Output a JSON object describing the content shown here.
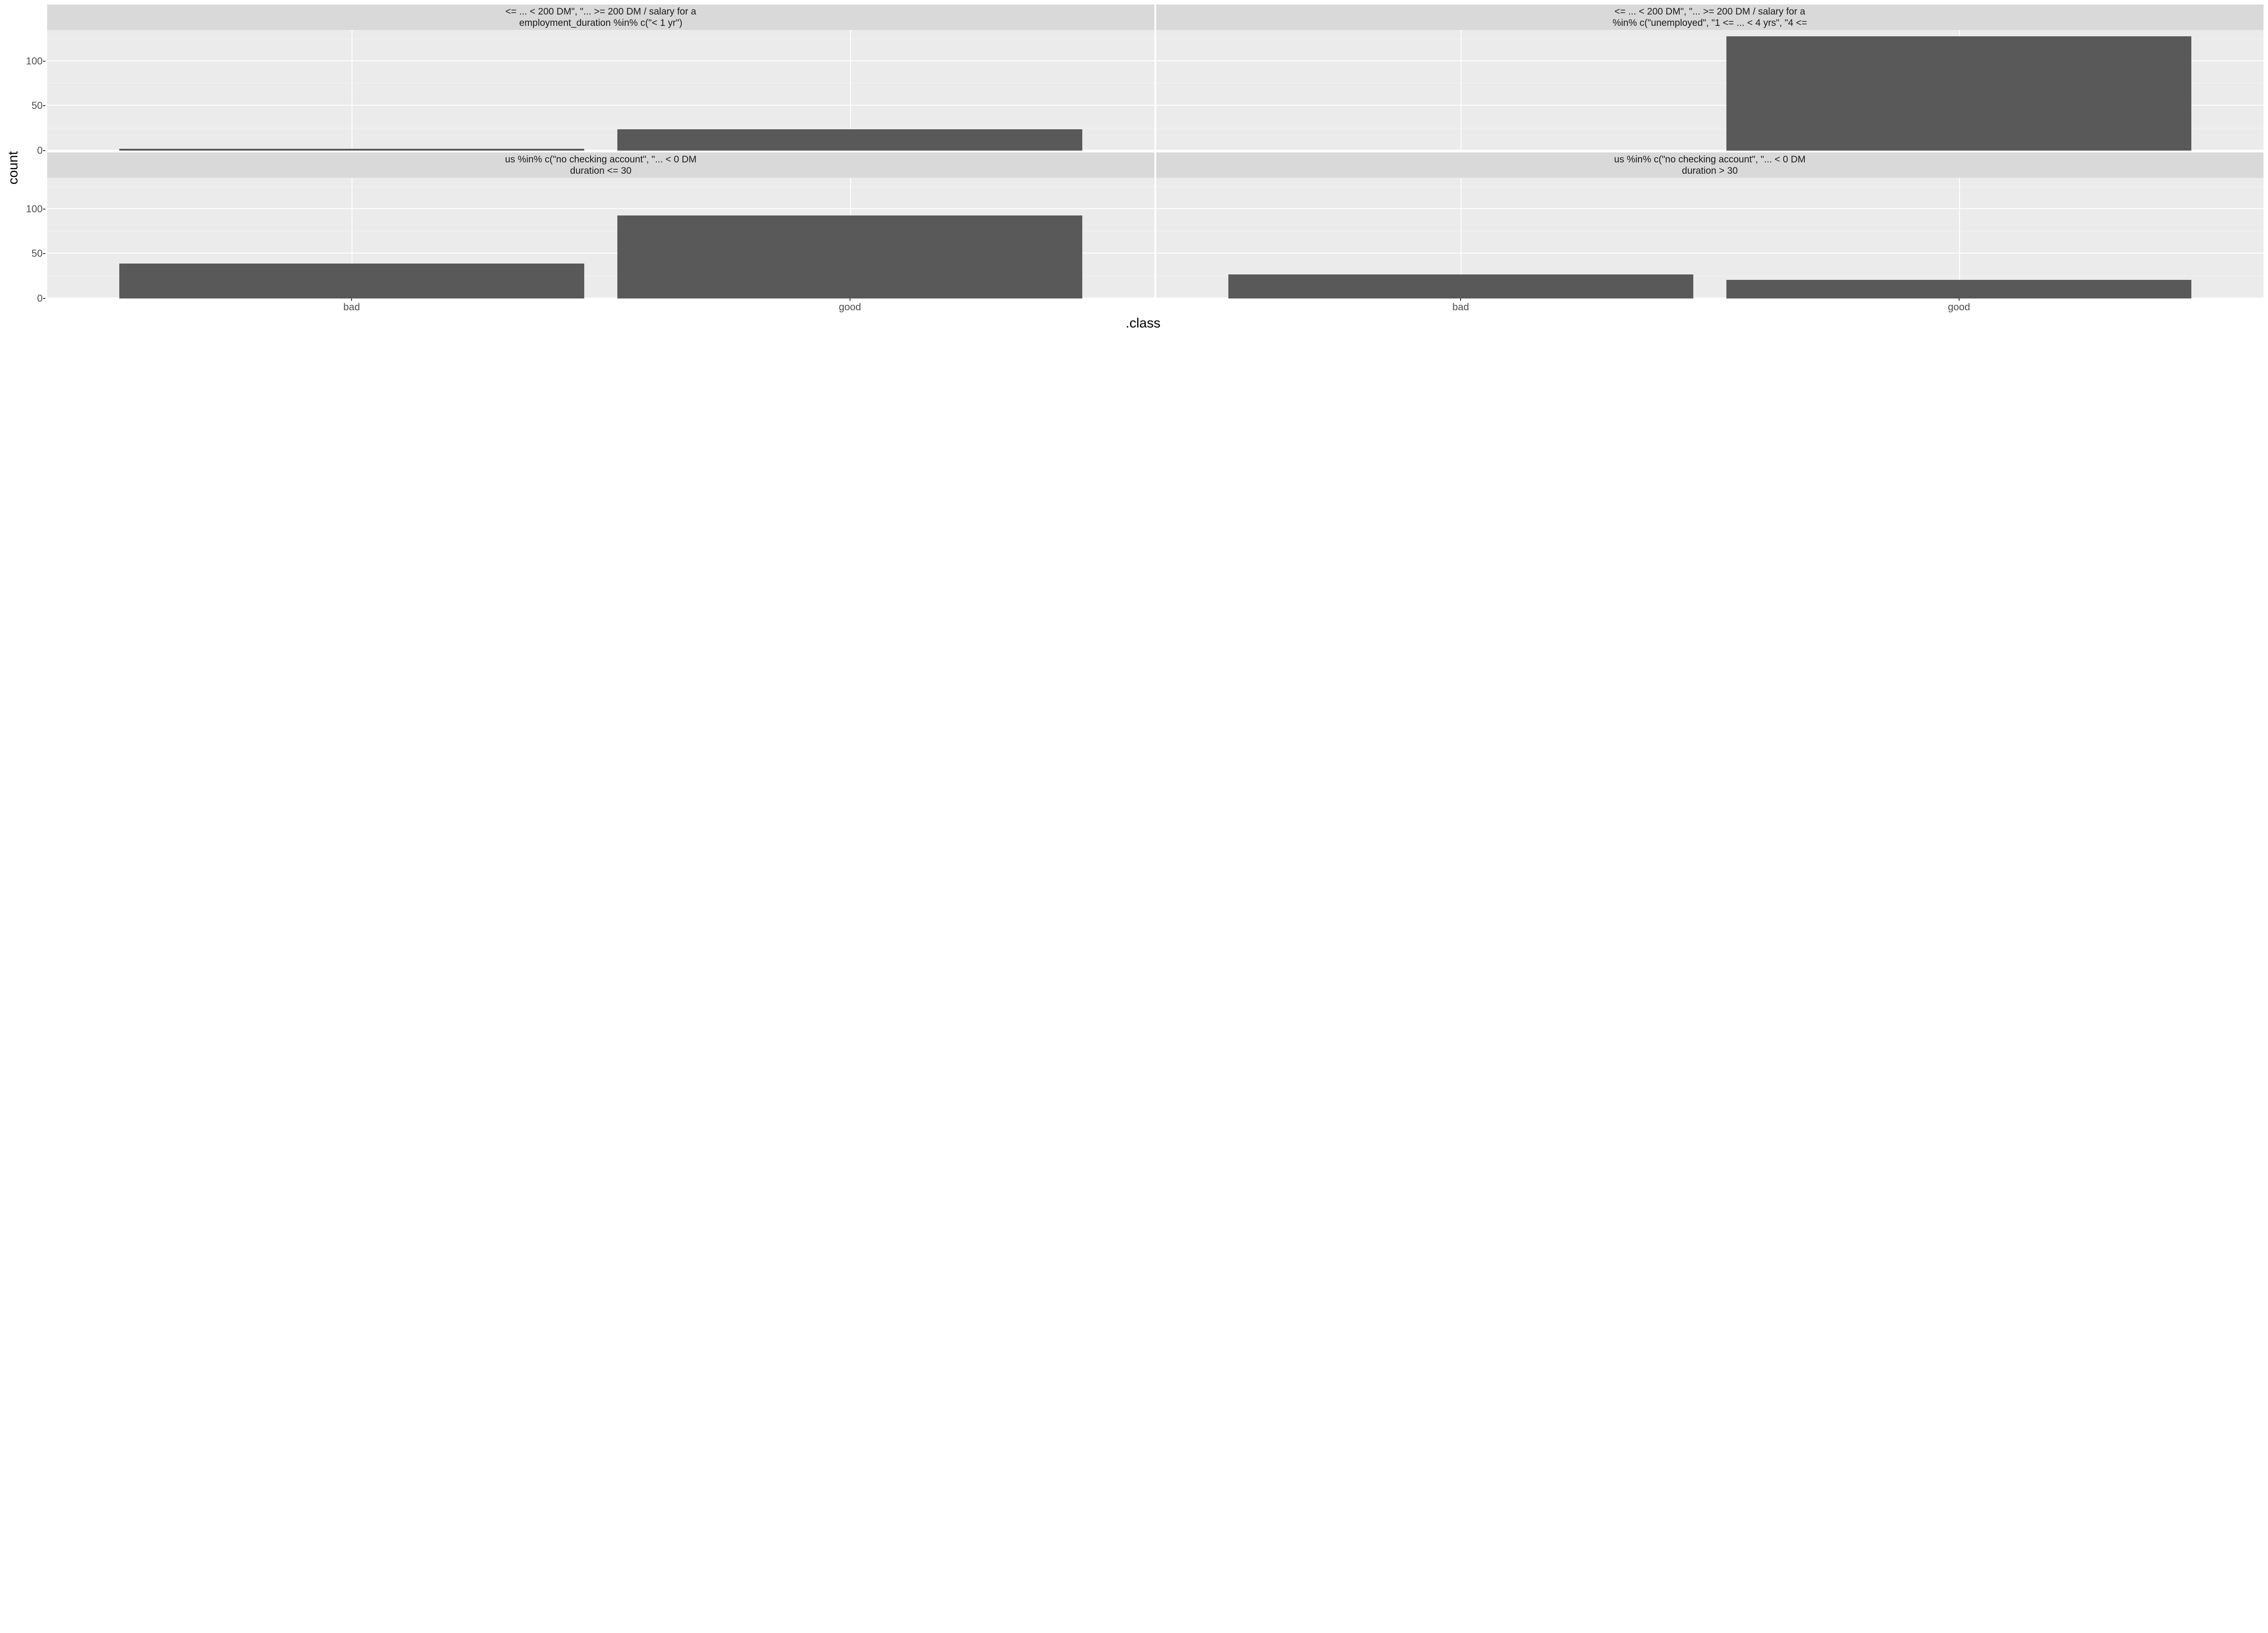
{
  "chart_data": [
    {
      "type": "bar",
      "facet_row": 0,
      "facet_col": 0,
      "strip_line1": "<= ... < 200 DM\", \"... >= 200 DM / salary for a",
      "strip_line2": "employment_duration %in% c(\"< 1 yr\")",
      "categories": [
        "bad",
        "good"
      ],
      "values": [
        2,
        24
      ],
      "xlabel": ".class",
      "ylabel": "count",
      "ylim": [
        0,
        135
      ],
      "yticks": [
        0,
        50,
        100
      ]
    },
    {
      "type": "bar",
      "facet_row": 0,
      "facet_col": 1,
      "strip_line1": "<= ... < 200 DM\", \"... >= 200 DM / salary for a",
      "strip_line2": "%in% c(\"unemployed\", \"1 <= ... < 4 yrs\", \"4 <=",
      "categories": [
        "bad",
        "good"
      ],
      "values": [
        0,
        128
      ],
      "xlabel": ".class",
      "ylabel": "count",
      "ylim": [
        0,
        135
      ],
      "yticks": [
        0,
        50,
        100
      ]
    },
    {
      "type": "bar",
      "facet_row": 1,
      "facet_col": 0,
      "strip_line1": "us %in% c(\"no checking account\", \"... < 0 DM",
      "strip_line2": "duration <= 30",
      "categories": [
        "bad",
        "good"
      ],
      "values": [
        39,
        93
      ],
      "xlabel": ".class",
      "ylabel": "count",
      "ylim": [
        0,
        135
      ],
      "yticks": [
        0,
        50,
        100
      ]
    },
    {
      "type": "bar",
      "facet_row": 1,
      "facet_col": 1,
      "strip_line1": "us %in% c(\"no checking account\", \"... < 0 DM",
      "strip_line2": "duration > 30",
      "categories": [
        "bad",
        "good"
      ],
      "values": [
        27,
        21
      ],
      "xlabel": ".class",
      "ylabel": "count",
      "ylim": [
        0,
        135
      ],
      "yticks": [
        0,
        50,
        100
      ]
    }
  ],
  "axis": {
    "xlabel": ".class",
    "ylabel": "count",
    "yticks": [
      "0",
      "50",
      "100"
    ],
    "xticks": [
      "bad",
      "good"
    ]
  },
  "colors": {
    "panel_bg": "#ebebeb",
    "strip_bg": "#d9d9d9",
    "bar_fill": "#595959",
    "grid_major": "#ffffff"
  }
}
